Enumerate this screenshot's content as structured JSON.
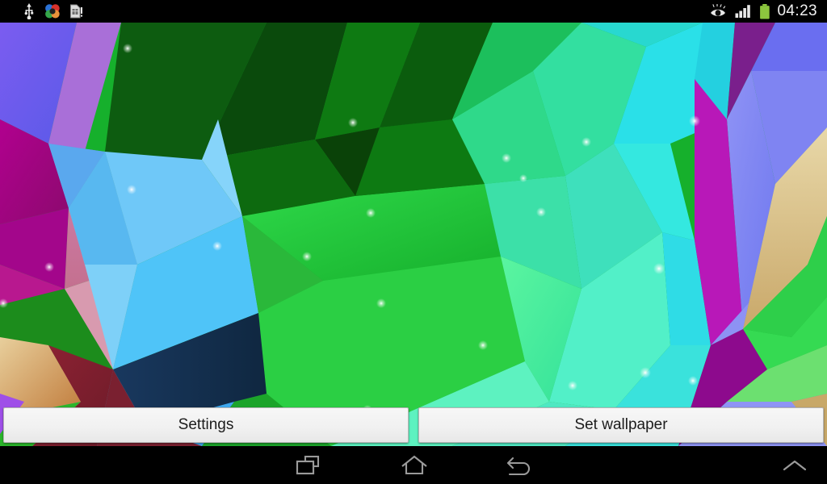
{
  "status_bar": {
    "left_icons": [
      {
        "name": "usb-icon",
        "label": "USB connected"
      },
      {
        "name": "google-photos-icon",
        "label": "Google app"
      },
      {
        "name": "sim-card-warning-icon",
        "label": "No SIM card"
      }
    ],
    "right_icons": [
      {
        "name": "smart-stay-eye-icon",
        "label": "Smart stay"
      },
      {
        "name": "signal-bars-icon",
        "label": "Signal strength",
        "bars": 4
      },
      {
        "name": "battery-icon",
        "label": "Battery",
        "color": "#8cc63e"
      }
    ],
    "clock": "04:23",
    "background_color": "#000000",
    "text_color": "#f2f2f2"
  },
  "wallpaper": {
    "name": "low-poly-crystal-live-wallpaper",
    "description": "Abstract low-poly crystal facets in green, cyan, blue, magenta and pink",
    "sparkle_color": "#ffffff"
  },
  "buttons": {
    "settings_label": "Settings",
    "set_wallpaper_label": "Set wallpaper"
  },
  "nav_bar": {
    "background_color": "#000000",
    "icon_color": "#9a9a9a",
    "items": [
      {
        "name": "recent-apps-icon",
        "label": "Recent apps"
      },
      {
        "name": "home-icon",
        "label": "Home"
      },
      {
        "name": "back-icon",
        "label": "Back"
      },
      {
        "name": "hide-navbar-chevron-up-icon",
        "label": "Hide navigation bar"
      }
    ]
  }
}
